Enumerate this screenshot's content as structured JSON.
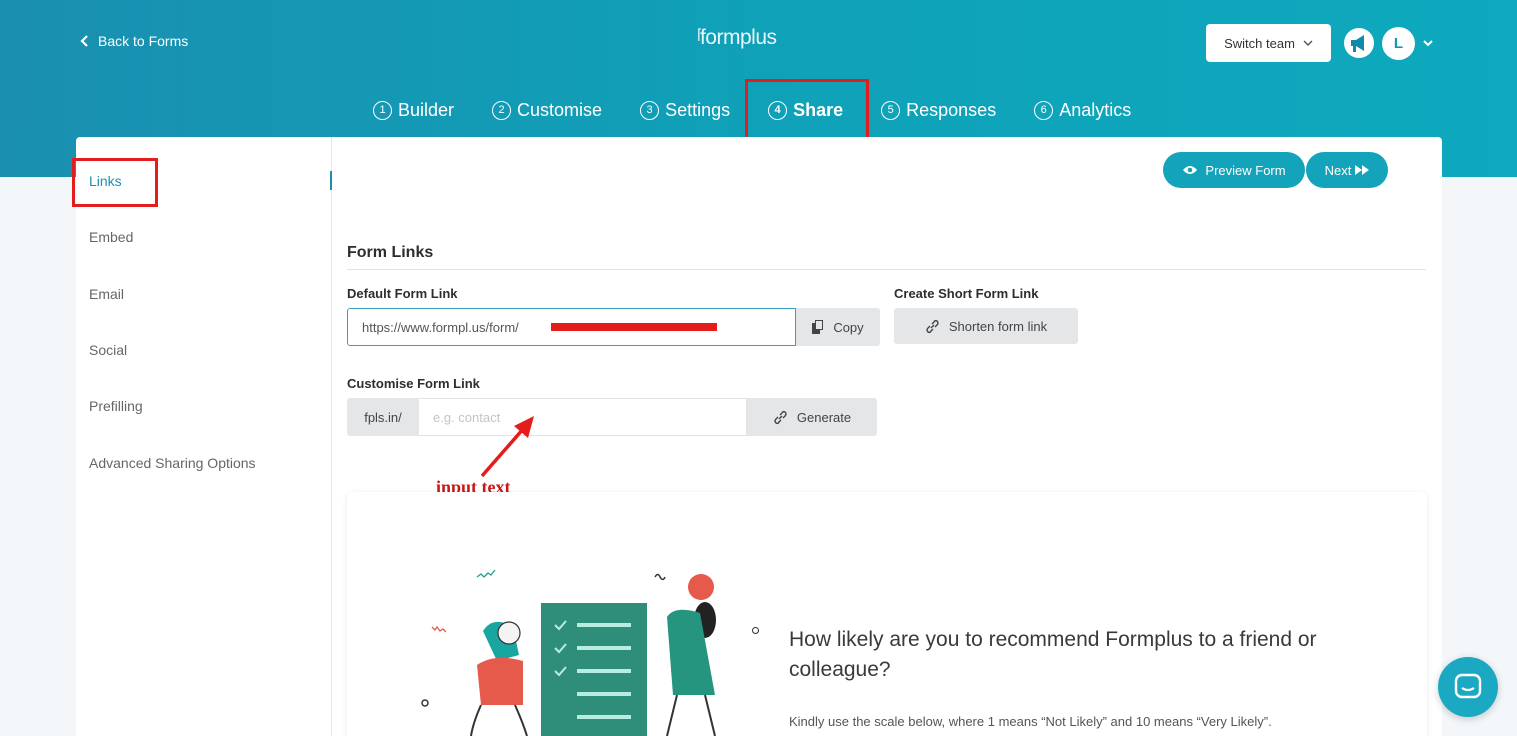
{
  "header": {
    "back_label": "Back to Forms",
    "logo_text": "formplus",
    "switch_team_label": "Switch team",
    "avatar_initial": "L"
  },
  "steps": [
    {
      "num": "1",
      "label": "Builder"
    },
    {
      "num": "2",
      "label": "Customise"
    },
    {
      "num": "3",
      "label": "Settings"
    },
    {
      "num": "4",
      "label": "Share",
      "active": true
    },
    {
      "num": "5",
      "label": "Responses"
    },
    {
      "num": "6",
      "label": "Analytics"
    }
  ],
  "sidebar": {
    "items": [
      {
        "label": "Links",
        "active": true
      },
      {
        "label": "Embed"
      },
      {
        "label": "Email"
      },
      {
        "label": "Social"
      },
      {
        "label": "Prefilling"
      },
      {
        "label": "Advanced Sharing Options"
      }
    ]
  },
  "actions": {
    "preview_label": "Preview Form",
    "next_label": "Next"
  },
  "form_links": {
    "title": "Form Links",
    "default_label": "Default Form Link",
    "default_url": "https://www.formpl.us/form/",
    "copy_label": "Copy",
    "short_label": "Create Short Form Link",
    "shorten_label": "Shorten form link",
    "customise_label": "Customise Form Link",
    "prefix": "fpls.in/",
    "custom_placeholder": "e.g. contact",
    "generate_label": "Generate"
  },
  "annotation": {
    "text": "input text"
  },
  "survey": {
    "question": "How likely are you to recommend Formplus to a friend or colleague?",
    "note": "Kindly use the scale below, where 1 means “Not Likely” and 10 means “Very Likely”."
  },
  "colors": {
    "accent": "#13a3bb",
    "highlight": "#e51c1c"
  }
}
